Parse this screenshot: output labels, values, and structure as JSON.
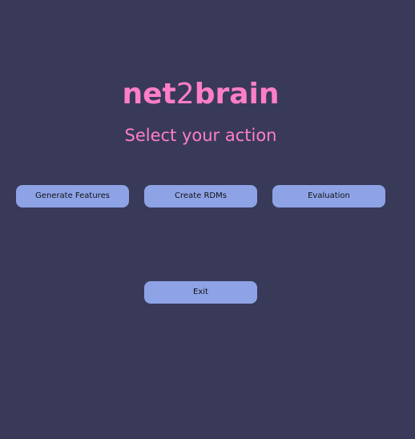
{
  "header": {
    "title_part1": "net",
    "title_part2": "2",
    "title_part3": "brain",
    "subtitle": "Select your action"
  },
  "actions": {
    "generate_features": "Generate Features",
    "create_rdms": "Create RDMs",
    "evaluation": "Evaluation",
    "exit": "Exit"
  },
  "colors": {
    "background": "#393a59",
    "accent": "#ff7ec8",
    "button": "#8ea3e6"
  }
}
